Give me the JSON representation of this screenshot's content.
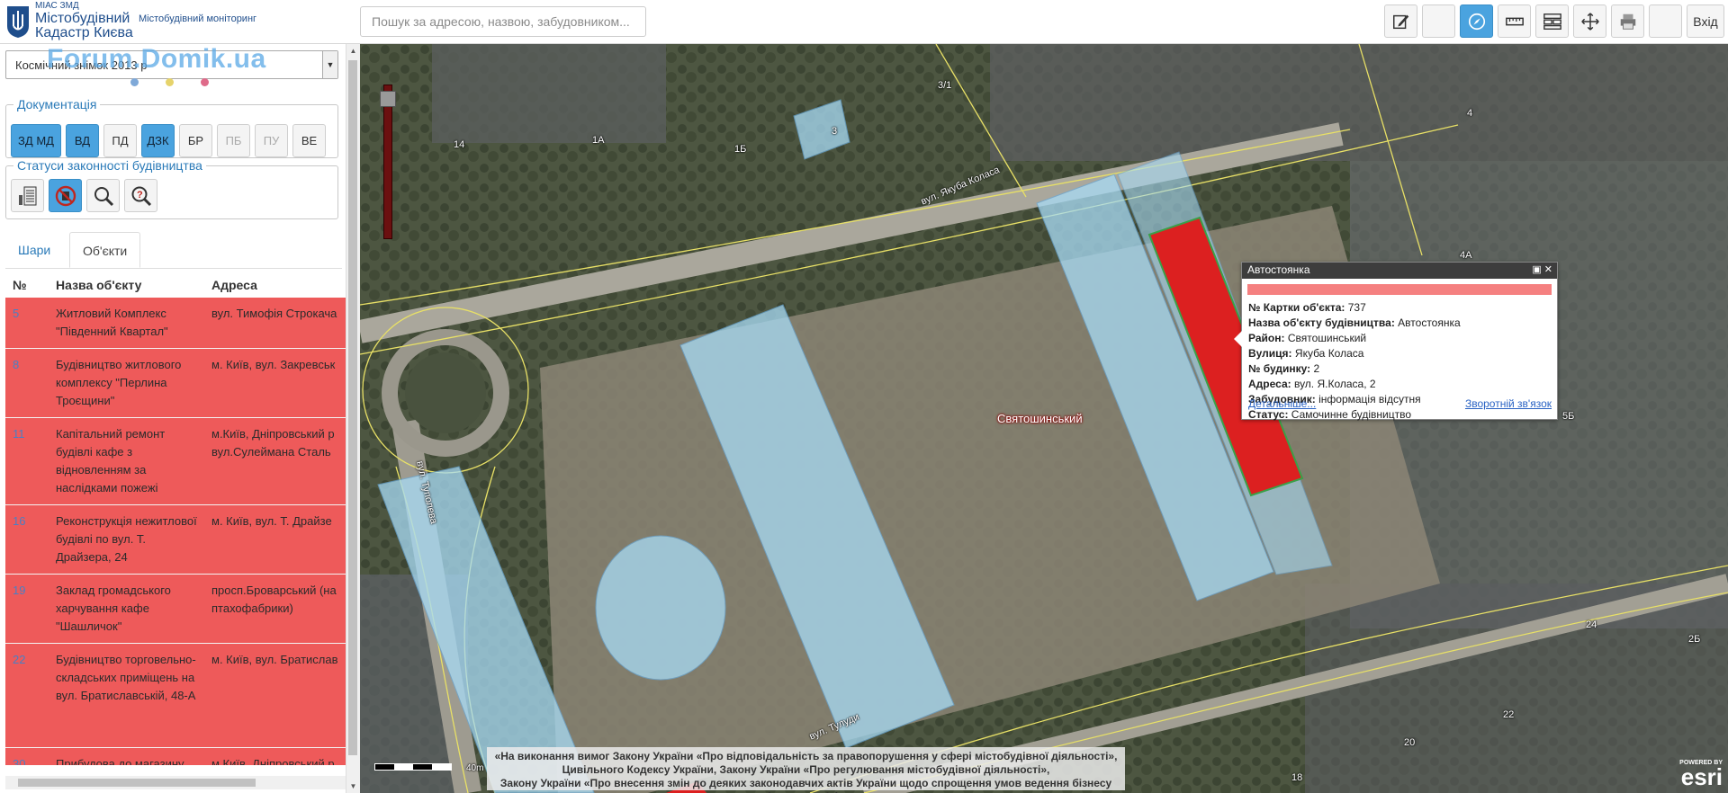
{
  "header": {
    "brand_small": "МІАС ЗМД",
    "brand_line1": "Містобудівний",
    "brand_line2": "Кадастр Києва",
    "brand_sub": "Містобудівний моніторинг",
    "search_placeholder": "Пошук за адресою, назвою, забудовником...",
    "login_label": "Вхід",
    "tools": [
      "edit-icon",
      "blank",
      "compass-icon",
      "ruler-icon",
      "layers-icon",
      "pan-icon",
      "print-icon",
      "blank"
    ]
  },
  "panel": {
    "watermark": "Forum.Domik.ua",
    "basemap_value": "Космічний знімок 2013 р",
    "doc_legend": "Документація",
    "doc_buttons": [
      {
        "label": "ЗД МД",
        "state": "on"
      },
      {
        "label": "ВД",
        "state": "on"
      },
      {
        "label": "ПД",
        "state": "off"
      },
      {
        "label": "ДЗК",
        "state": "on"
      },
      {
        "label": "БР",
        "state": "off"
      },
      {
        "label": "ПБ",
        "state": "dim"
      },
      {
        "label": "ПУ",
        "state": "dim"
      },
      {
        "label": "ВЕ",
        "state": "off"
      }
    ],
    "status_legend": "Статуси законності будівництва",
    "tabs": [
      "Шари",
      "Об'єкти"
    ],
    "columns": [
      "№",
      "Назва об'єкту",
      "Адреса"
    ],
    "rows": [
      {
        "num": "5",
        "name": "Житловий Комплекс \"Південний Квартал\"",
        "addr": "вул. Тимофія Строкача"
      },
      {
        "num": "8",
        "name": "Будівництво житлового комплексу \"Перлина Троєщини\"",
        "addr": "м. Київ, вул. Закревськ"
      },
      {
        "num": "11",
        "name": "Капітальний ремонт будівлі кафе з відновленням за наслідками пожежі",
        "addr": "м.Київ, Дніпровський р\nвул.Сулеймана Сталь"
      },
      {
        "num": "16",
        "name": "Реконструкція нежитлової будівлі по вул. Т. Драйзера, 24",
        "addr": "м. Київ, вул. Т. Драйзе"
      },
      {
        "num": "19",
        "name": "Заклад громадського харчування кафе \"Шашличок\"",
        "addr": "просп.Броварський (на\nптахофабрики)"
      },
      {
        "num": "22",
        "name": "Будівництво торговельно-складських приміщень на вул. Братиславській, 48-А",
        "addr": "м. Київ, вул. Братислав"
      },
      {
        "num": "30",
        "name": "Прибудова до магазину",
        "addr": "м.Київ, Дніпровський р"
      }
    ]
  },
  "map": {
    "labels": [
      "3/1",
      "14",
      "1А",
      "1Б",
      "3",
      "4",
      "4А",
      "24",
      "2Б",
      "22",
      "20",
      "18",
      "5Б"
    ],
    "streets": [
      "вул. Якуба Коласа",
      "вул. Туполева",
      "вул. Тулуди"
    ],
    "district": "Святошинський",
    "law_text": [
      "«На виконання вимог Закону України «Про відповідальність за правопорушення у сфері містобудівної діяльності»,",
      "Цивільного Кодексу України, Закону України «Про регулювання містобудівної діяльності»,",
      "Закону України «Про внесення змін до деяких законодавчих актів України щодо спрощення умов ведення бізнесу (дерегуляція)»"
    ],
    "scale_label": "40m",
    "esri_powered": "POWERED BY",
    "esri_name": "esri"
  },
  "popup": {
    "title": "Автостоянка",
    "fields": [
      {
        "k": "№ Картки об'єкта:",
        "v": " 737"
      },
      {
        "k": "Назва об'єкту будівництва:",
        "v": " Автостоянка"
      },
      {
        "k": "Район:",
        "v": " Святошинський"
      },
      {
        "k": "Вулиця:",
        "v": " Якуба Коласа"
      },
      {
        "k": "№ будинку:",
        "v": " 2"
      },
      {
        "k": "Адреса:",
        "v": " вул. Я.Коласа, 2"
      },
      {
        "k": "Забудовник:",
        "v": " інформація відсутня"
      },
      {
        "k": "Статус:",
        "v": " Самочинне будівництво"
      }
    ],
    "link_details": "Детальніше...",
    "link_feedback": "Зворотній зв'язок"
  },
  "colors": {
    "accent": "#4aa3df",
    "row_red": "#ee5a5a",
    "feature_red": "#dc2020",
    "feature_blue": "#9fd6f3"
  }
}
